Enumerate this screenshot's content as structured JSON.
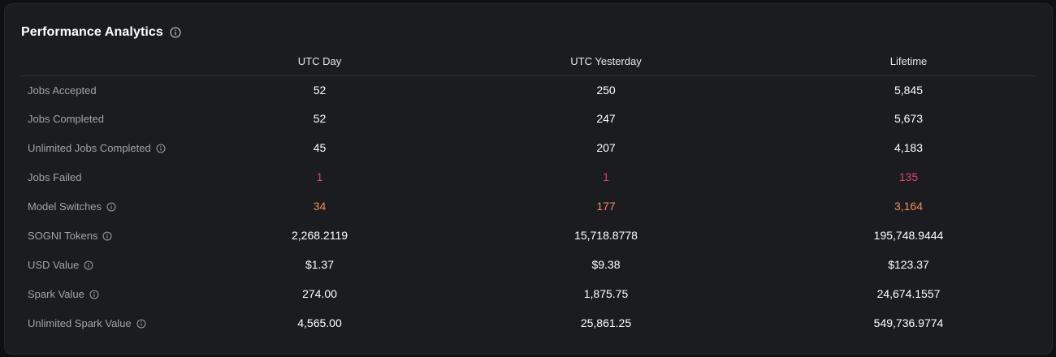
{
  "panel": {
    "title": "Performance Analytics"
  },
  "columns": [
    "",
    "UTC Day",
    "UTC Yesterday",
    "Lifetime"
  ],
  "rows": [
    {
      "label": "Jobs Accepted",
      "info": false,
      "tone": "normal",
      "values": [
        "52",
        "250",
        "5,845"
      ]
    },
    {
      "label": "Jobs Completed",
      "info": false,
      "tone": "normal",
      "values": [
        "52",
        "247",
        "5,673"
      ]
    },
    {
      "label": "Unlimited Jobs Completed",
      "info": true,
      "tone": "normal",
      "values": [
        "45",
        "207",
        "4,183"
      ]
    },
    {
      "label": "Jobs Failed",
      "info": false,
      "tone": "failed",
      "values": [
        "1",
        "1",
        "135"
      ]
    },
    {
      "label": "Model Switches",
      "info": true,
      "tone": "switch",
      "values": [
        "34",
        "177",
        "3,164"
      ]
    },
    {
      "label": "SOGNI Tokens",
      "info": true,
      "tone": "normal",
      "values": [
        "2,268.2119",
        "15,718.8778",
        "195,748.9444"
      ]
    },
    {
      "label": "USD Value",
      "info": true,
      "tone": "normal",
      "values": [
        "$1.37",
        "$9.38",
        "$123.37"
      ]
    },
    {
      "label": "Spark Value",
      "info": true,
      "tone": "normal",
      "values": [
        "274.00",
        "1,875.75",
        "24,674.1557"
      ]
    },
    {
      "label": "Unlimited Spark Value",
      "info": true,
      "tone": "normal",
      "values": [
        "4,565.00",
        "25,861.25",
        "549,736.9774"
      ]
    }
  ],
  "colors": {
    "failed": "#e0456a",
    "switch": "#f28a5b",
    "text": "#ffffff",
    "muted": "#a3a4a9"
  },
  "icons": {
    "info": "info-circle-icon"
  }
}
